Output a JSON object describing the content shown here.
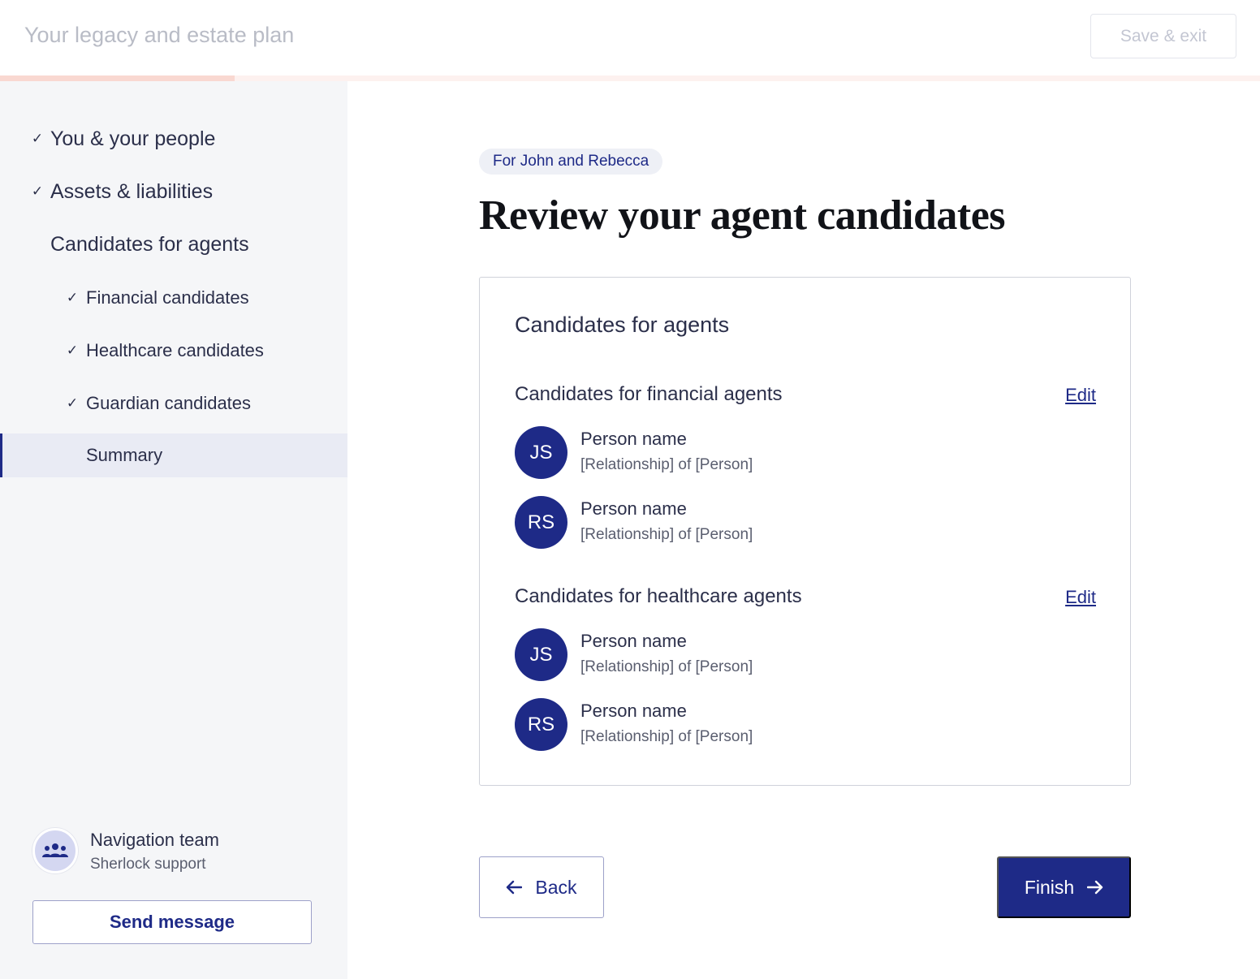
{
  "header": {
    "app_title": "Your legacy and estate plan",
    "save_exit_label": "Save & exit",
    "progress_fraction": 0.186
  },
  "sidebar": {
    "items": [
      {
        "label": "You & your people",
        "checked": true,
        "level": "top"
      },
      {
        "label": "Assets & liabilities",
        "checked": true,
        "level": "top"
      },
      {
        "label": "Candidates for agents",
        "checked": false,
        "level": "top"
      },
      {
        "label": "Financial candidates",
        "checked": true,
        "level": "sub"
      },
      {
        "label": "Healthcare candidates",
        "checked": true,
        "level": "sub"
      },
      {
        "label": "Guardian candidates",
        "checked": true,
        "level": "sub"
      },
      {
        "label": "Summary",
        "checked": false,
        "level": "sub",
        "active": true
      }
    ],
    "check_glyph": "✓",
    "support": {
      "name": "Navigation team",
      "subtitle": "Sherlock support",
      "icon": "group-icon"
    },
    "send_message_label": "Send message"
  },
  "main": {
    "pill": "For John and Rebecca",
    "title": "Review your agent candidates",
    "card": {
      "title": "Candidates for agents",
      "sections": [
        {
          "title": "Candidates for financial agents",
          "edit_label": "Edit",
          "people": [
            {
              "initials": "JS",
              "name": "Person name",
              "relationship": "[Relationship] of [Person]"
            },
            {
              "initials": "RS",
              "name": "Person name",
              "relationship": "[Relationship] of [Person]"
            }
          ]
        },
        {
          "title": "Candidates for healthcare agents",
          "edit_label": "Edit",
          "people": [
            {
              "initials": "JS",
              "name": "Person name",
              "relationship": "[Relationship] of [Person]"
            },
            {
              "initials": "RS",
              "name": "Person name",
              "relationship": "[Relationship] of [Person]"
            }
          ]
        }
      ]
    },
    "back_label": "Back",
    "finish_label": "Finish"
  },
  "colors": {
    "brand": "#1e2a87",
    "progress": "#f9d8d1",
    "sidebar_bg": "#f5f6f8",
    "active_bg": "#e9ebf4"
  }
}
